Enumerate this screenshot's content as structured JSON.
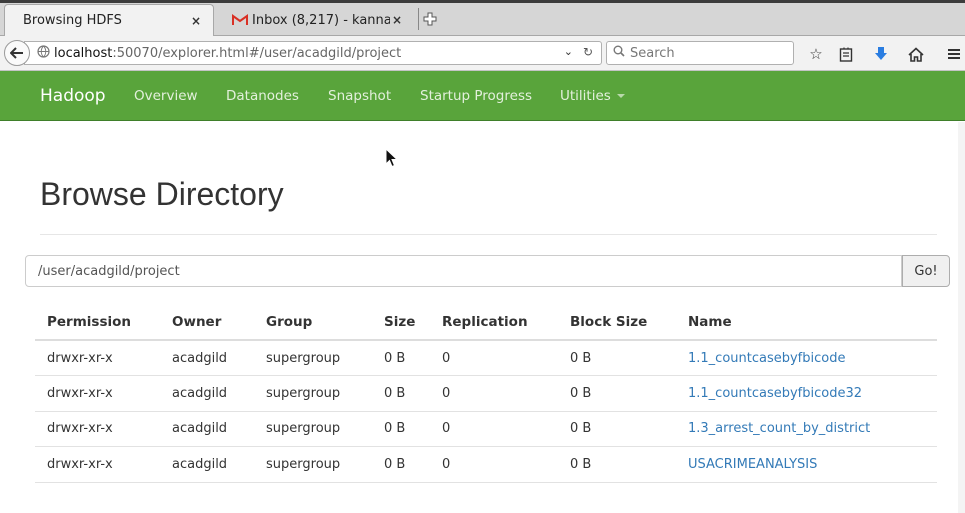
{
  "browser": {
    "tabs": [
      {
        "title": "Browsing HDFS",
        "close": "×",
        "icon": "none",
        "active": true
      },
      {
        "title": "Inbox (8,217) - kanna...",
        "close": "×",
        "icon": "gmail-icon",
        "active": false
      }
    ],
    "new_tab_icon": "plus-icon",
    "url_host": "localhost",
    "url_rest": ":50070/explorer.html#/user/acadgild/project",
    "search_placeholder": "Search",
    "toolbar_icons": [
      "star-icon",
      "reading-list-icon",
      "download-icon",
      "home-icon",
      "menu-icon"
    ]
  },
  "hadoop_nav": {
    "brand": "Hadoop",
    "items": [
      "Overview",
      "Datanodes",
      "Snapshot",
      "Startup Progress",
      "Utilities"
    ],
    "bg_color": "#59a43b"
  },
  "page": {
    "title": "Browse Directory",
    "path_value": "/user/acadgild/project",
    "go_label": "Go!"
  },
  "table": {
    "headers": [
      "Permission",
      "Owner",
      "Group",
      "Size",
      "Replication",
      "Block Size",
      "Name"
    ],
    "rows": [
      [
        "drwxr-xr-x",
        "acadgild",
        "supergroup",
        "0 B",
        "0",
        "0 B",
        "1.1_countcasebyfbicode"
      ],
      [
        "drwxr-xr-x",
        "acadgild",
        "supergroup",
        "0 B",
        "0",
        "0 B",
        "1.1_countcasebyfbicode32"
      ],
      [
        "drwxr-xr-x",
        "acadgild",
        "supergroup",
        "0 B",
        "0",
        "0 B",
        "1.3_arrest_count_by_district"
      ],
      [
        "drwxr-xr-x",
        "acadgild",
        "supergroup",
        "0 B",
        "0",
        "0 B",
        "USACRIMEANALYSIS"
      ]
    ],
    "link_color": "#337ab7"
  }
}
